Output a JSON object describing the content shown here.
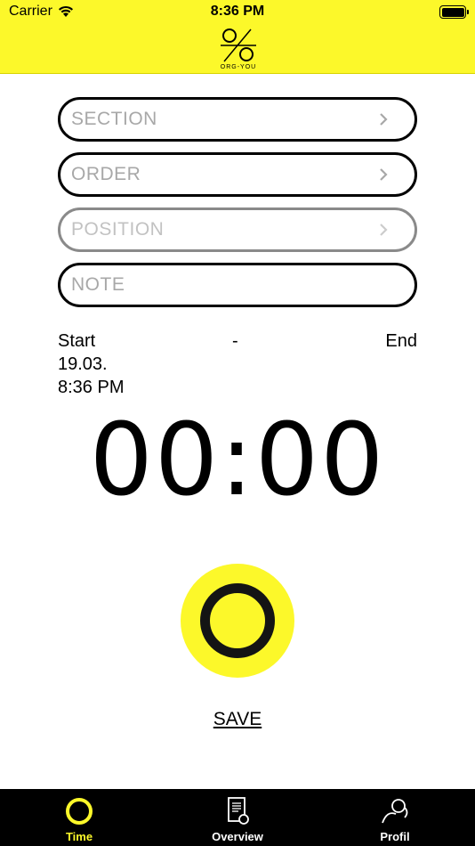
{
  "status_bar": {
    "carrier": "Carrier",
    "time": "8:36 PM"
  },
  "header": {
    "logo_text": "ORG-YOU",
    "background_color": "#fcf82a"
  },
  "form": {
    "section_placeholder": "SECTION",
    "order_placeholder": "ORDER",
    "position_placeholder": "POSITION",
    "note_placeholder": "NOTE"
  },
  "times": {
    "start_label": "Start",
    "separator": "-",
    "end_label": "End",
    "start_date": "19.03.",
    "start_time": "8:36 PM"
  },
  "timer": {
    "display": "00:00"
  },
  "actions": {
    "save_label": "SAVE"
  },
  "tabbar": {
    "tabs": [
      {
        "label": "Time",
        "icon": "circle-icon",
        "active": true
      },
      {
        "label": "Overview",
        "icon": "document-icon",
        "active": false
      },
      {
        "label": "Profil",
        "icon": "profile-icon",
        "active": false
      }
    ],
    "active_color": "#fcf82a"
  }
}
